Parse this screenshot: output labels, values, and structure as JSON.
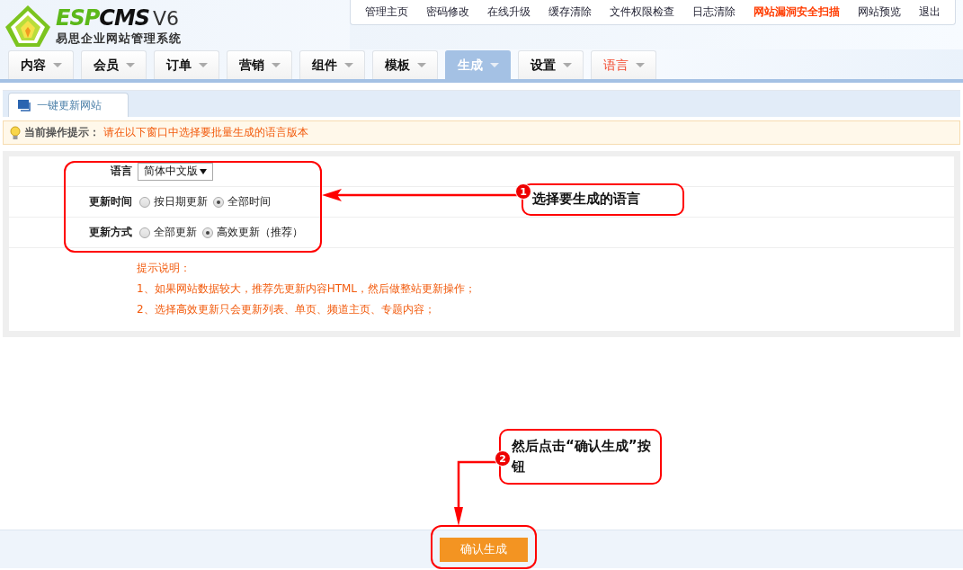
{
  "logo": {
    "brand_prefix": "ESP",
    "brand_suffix": "CMS",
    "version": "V6",
    "subtitle": "易思企业网站管理系统"
  },
  "top_links": [
    {
      "label": "管理主页",
      "highlight": false
    },
    {
      "label": "密码修改",
      "highlight": false
    },
    {
      "label": "在线升级",
      "highlight": false
    },
    {
      "label": "缓存清除",
      "highlight": false
    },
    {
      "label": "文件权限检查",
      "highlight": false
    },
    {
      "label": "日志清除",
      "highlight": false
    },
    {
      "label": "网站漏洞安全扫描",
      "highlight": true
    },
    {
      "label": "网站预览",
      "highlight": false
    },
    {
      "label": "退出",
      "highlight": false
    }
  ],
  "nav_tabs": [
    {
      "label": "内容",
      "selected": false,
      "highlight": false
    },
    {
      "label": "会员",
      "selected": false,
      "highlight": false
    },
    {
      "label": "订单",
      "selected": false,
      "highlight": false
    },
    {
      "label": "营销",
      "selected": false,
      "highlight": false
    },
    {
      "label": "组件",
      "selected": false,
      "highlight": false
    },
    {
      "label": "模板",
      "selected": false,
      "highlight": false
    },
    {
      "label": "生成",
      "selected": true,
      "highlight": false
    },
    {
      "label": "设置",
      "selected": false,
      "highlight": false
    },
    {
      "label": "语言",
      "selected": false,
      "highlight": true
    }
  ],
  "page_tab": {
    "label": "一键更新网站"
  },
  "tip": {
    "label": "当前操作提示：",
    "text": "请在以下窗口中选择要批量生成的语言版本"
  },
  "form": {
    "rows": [
      {
        "kind": "select",
        "label": "语言",
        "value": "简体中文版"
      },
      {
        "kind": "radio",
        "label": "更新时间",
        "options": [
          {
            "label": "按日期更新",
            "selected": false
          },
          {
            "label": "全部时间",
            "selected": true
          }
        ]
      },
      {
        "kind": "radio",
        "label": "更新方式",
        "options": [
          {
            "label": "全部更新",
            "selected": false
          },
          {
            "label": "高效更新（推荐）",
            "selected": true
          }
        ]
      }
    ],
    "notes": [
      "提示说明：",
      "1、如果网站数据较大，推荐先更新内容HTML，然后做整站更新操作；",
      "2、选择高效更新只会更新列表、单页、频道主页、专题内容；"
    ]
  },
  "submit_button": {
    "label": "确认生成"
  },
  "annotations": [
    {
      "number": "1",
      "text": "选择要生成的语言"
    },
    {
      "number": "2",
      "text": "然后点击“确认生成”按钮"
    }
  ]
}
